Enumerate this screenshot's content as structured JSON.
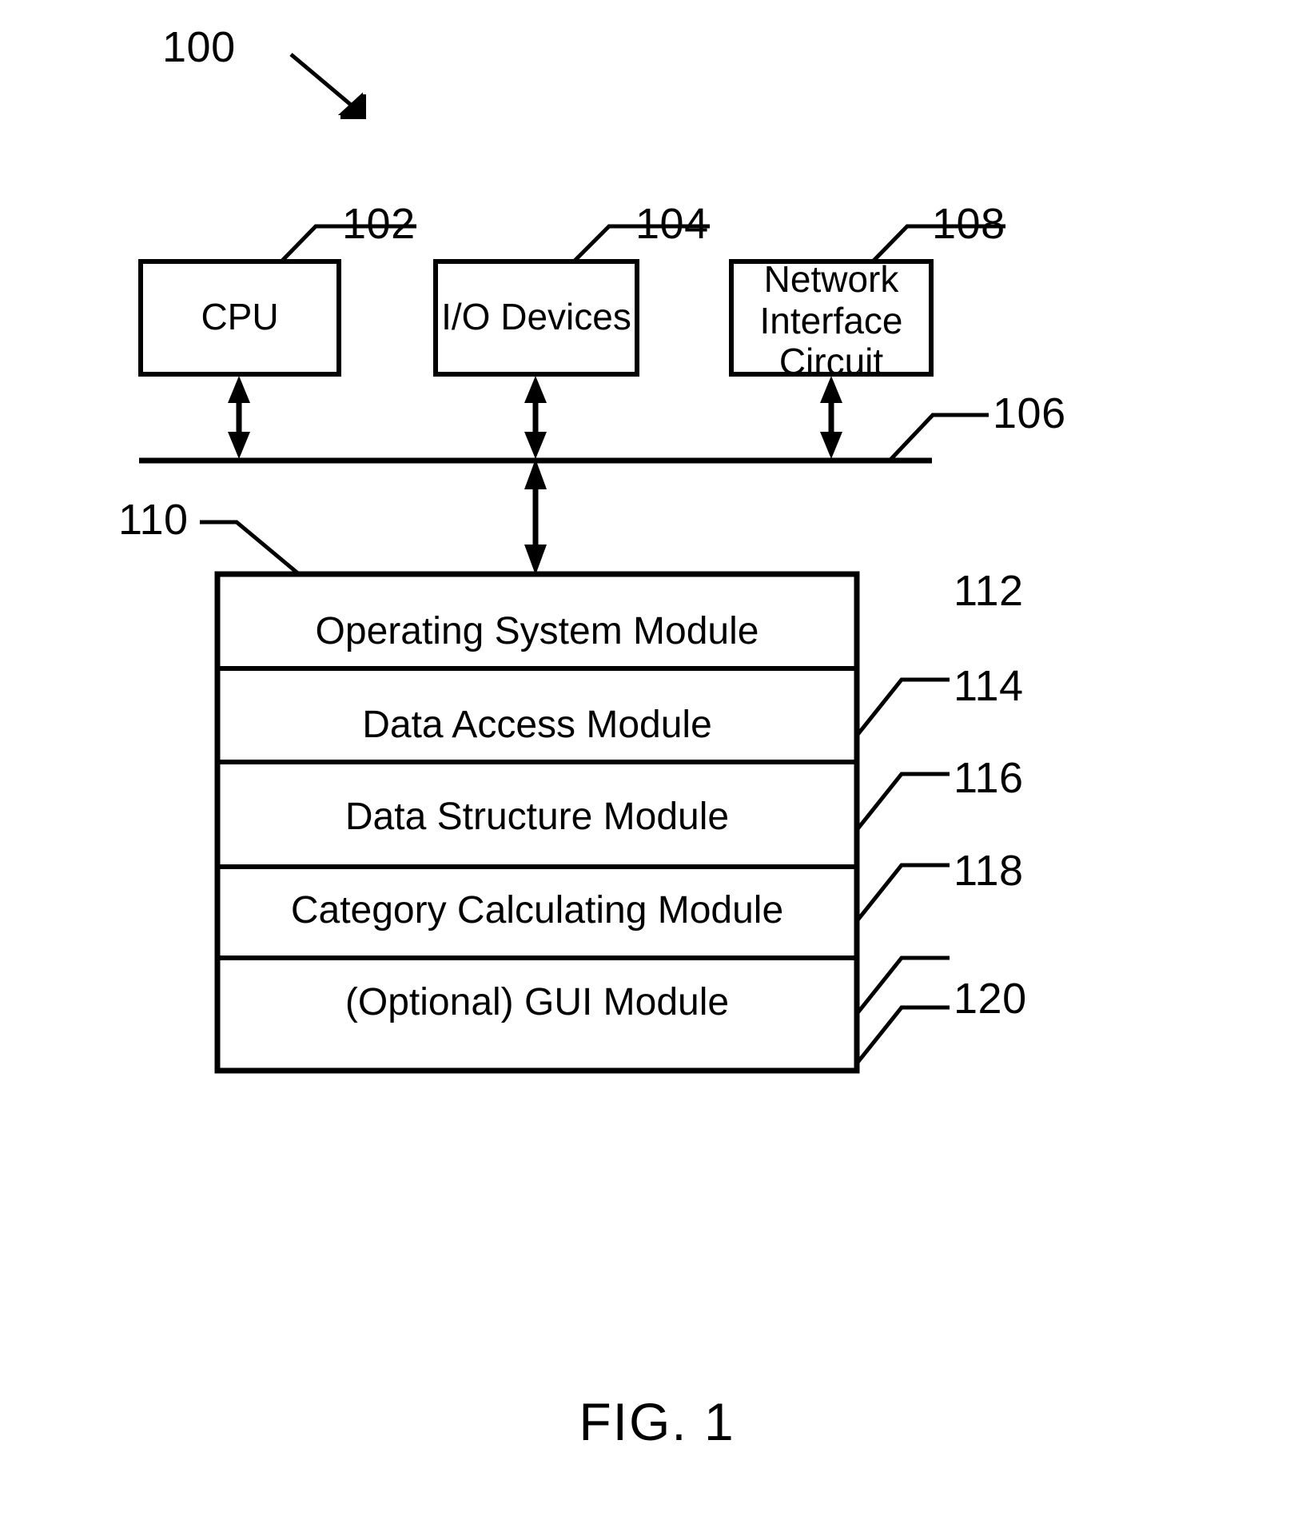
{
  "figure": {
    "caption": "FIG. 1",
    "system_ref": "100"
  },
  "top_boxes": [
    {
      "label": "CPU",
      "ref": "102"
    },
    {
      "label": "I/O Devices",
      "ref": "104"
    },
    {
      "label": "Network\nInterface\nCircuit",
      "ref": "108"
    }
  ],
  "bus": {
    "ref": "106"
  },
  "memory": {
    "ref": "110",
    "modules": [
      {
        "label": "Operating System Module",
        "ref": "112"
      },
      {
        "label": "Data Access Module",
        "ref": "114"
      },
      {
        "label": "Data Structure Module",
        "ref": "116"
      },
      {
        "label": "Category Calculating Module",
        "ref": "118"
      },
      {
        "label": "(Optional) GUI Module",
        "ref": "120"
      }
    ]
  },
  "colors": {
    "ink": "#000000",
    "paper": "#ffffff"
  }
}
